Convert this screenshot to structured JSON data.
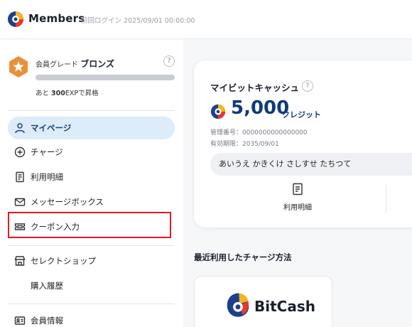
{
  "header": {
    "brand": "Members",
    "last_login": "前回ログイン 2025/09/01 00:00:00",
    "logo_icon": "brand-logo-icon"
  },
  "sidebar": {
    "grade": {
      "label": "会員グレード",
      "name": "ブロンズ",
      "progress": 0.0,
      "exp_prefix": "あと",
      "exp_value": "300",
      "exp_suffix": "EXPで昇格",
      "badge_icon": "star-badge-icon"
    },
    "nav": [
      {
        "label": "マイページ",
        "icon": "user-icon",
        "active": true
      },
      {
        "label": "チャージ",
        "icon": "plus-circle-icon",
        "active": false
      },
      {
        "label": "利用明細",
        "icon": "document-icon",
        "active": false
      },
      {
        "label": "メッセージボックス",
        "icon": "mail-icon",
        "active": false
      },
      {
        "label": "クーポン入力",
        "icon": "ticket-icon",
        "active": false
      },
      {
        "label": "セレクトショップ",
        "icon": "shop-icon",
        "active": false
      },
      {
        "label": "購入履歴",
        "icon": "",
        "active": false
      },
      {
        "label": "会員情報",
        "icon": "id-card-icon",
        "active": false
      }
    ]
  },
  "cash_card": {
    "title": "マイビットキャッシュ",
    "amount": "5,000",
    "unit": "クレジット",
    "id_line": "管理番号：0000000000000000",
    "expiry_line": "有効期限：2035/09/01",
    "kana": "あいうえ かきくけ さしすせ たちつて",
    "history_label": "利用明細"
  },
  "recent": {
    "title": "最近利用したチャージ方法",
    "method_name": "BitCash"
  },
  "colors": {
    "accent_navy": "#103a7a",
    "active_nav_bg": "#dcecf8",
    "highlight_red": "#e11b22",
    "bronze": "#e8913a"
  }
}
